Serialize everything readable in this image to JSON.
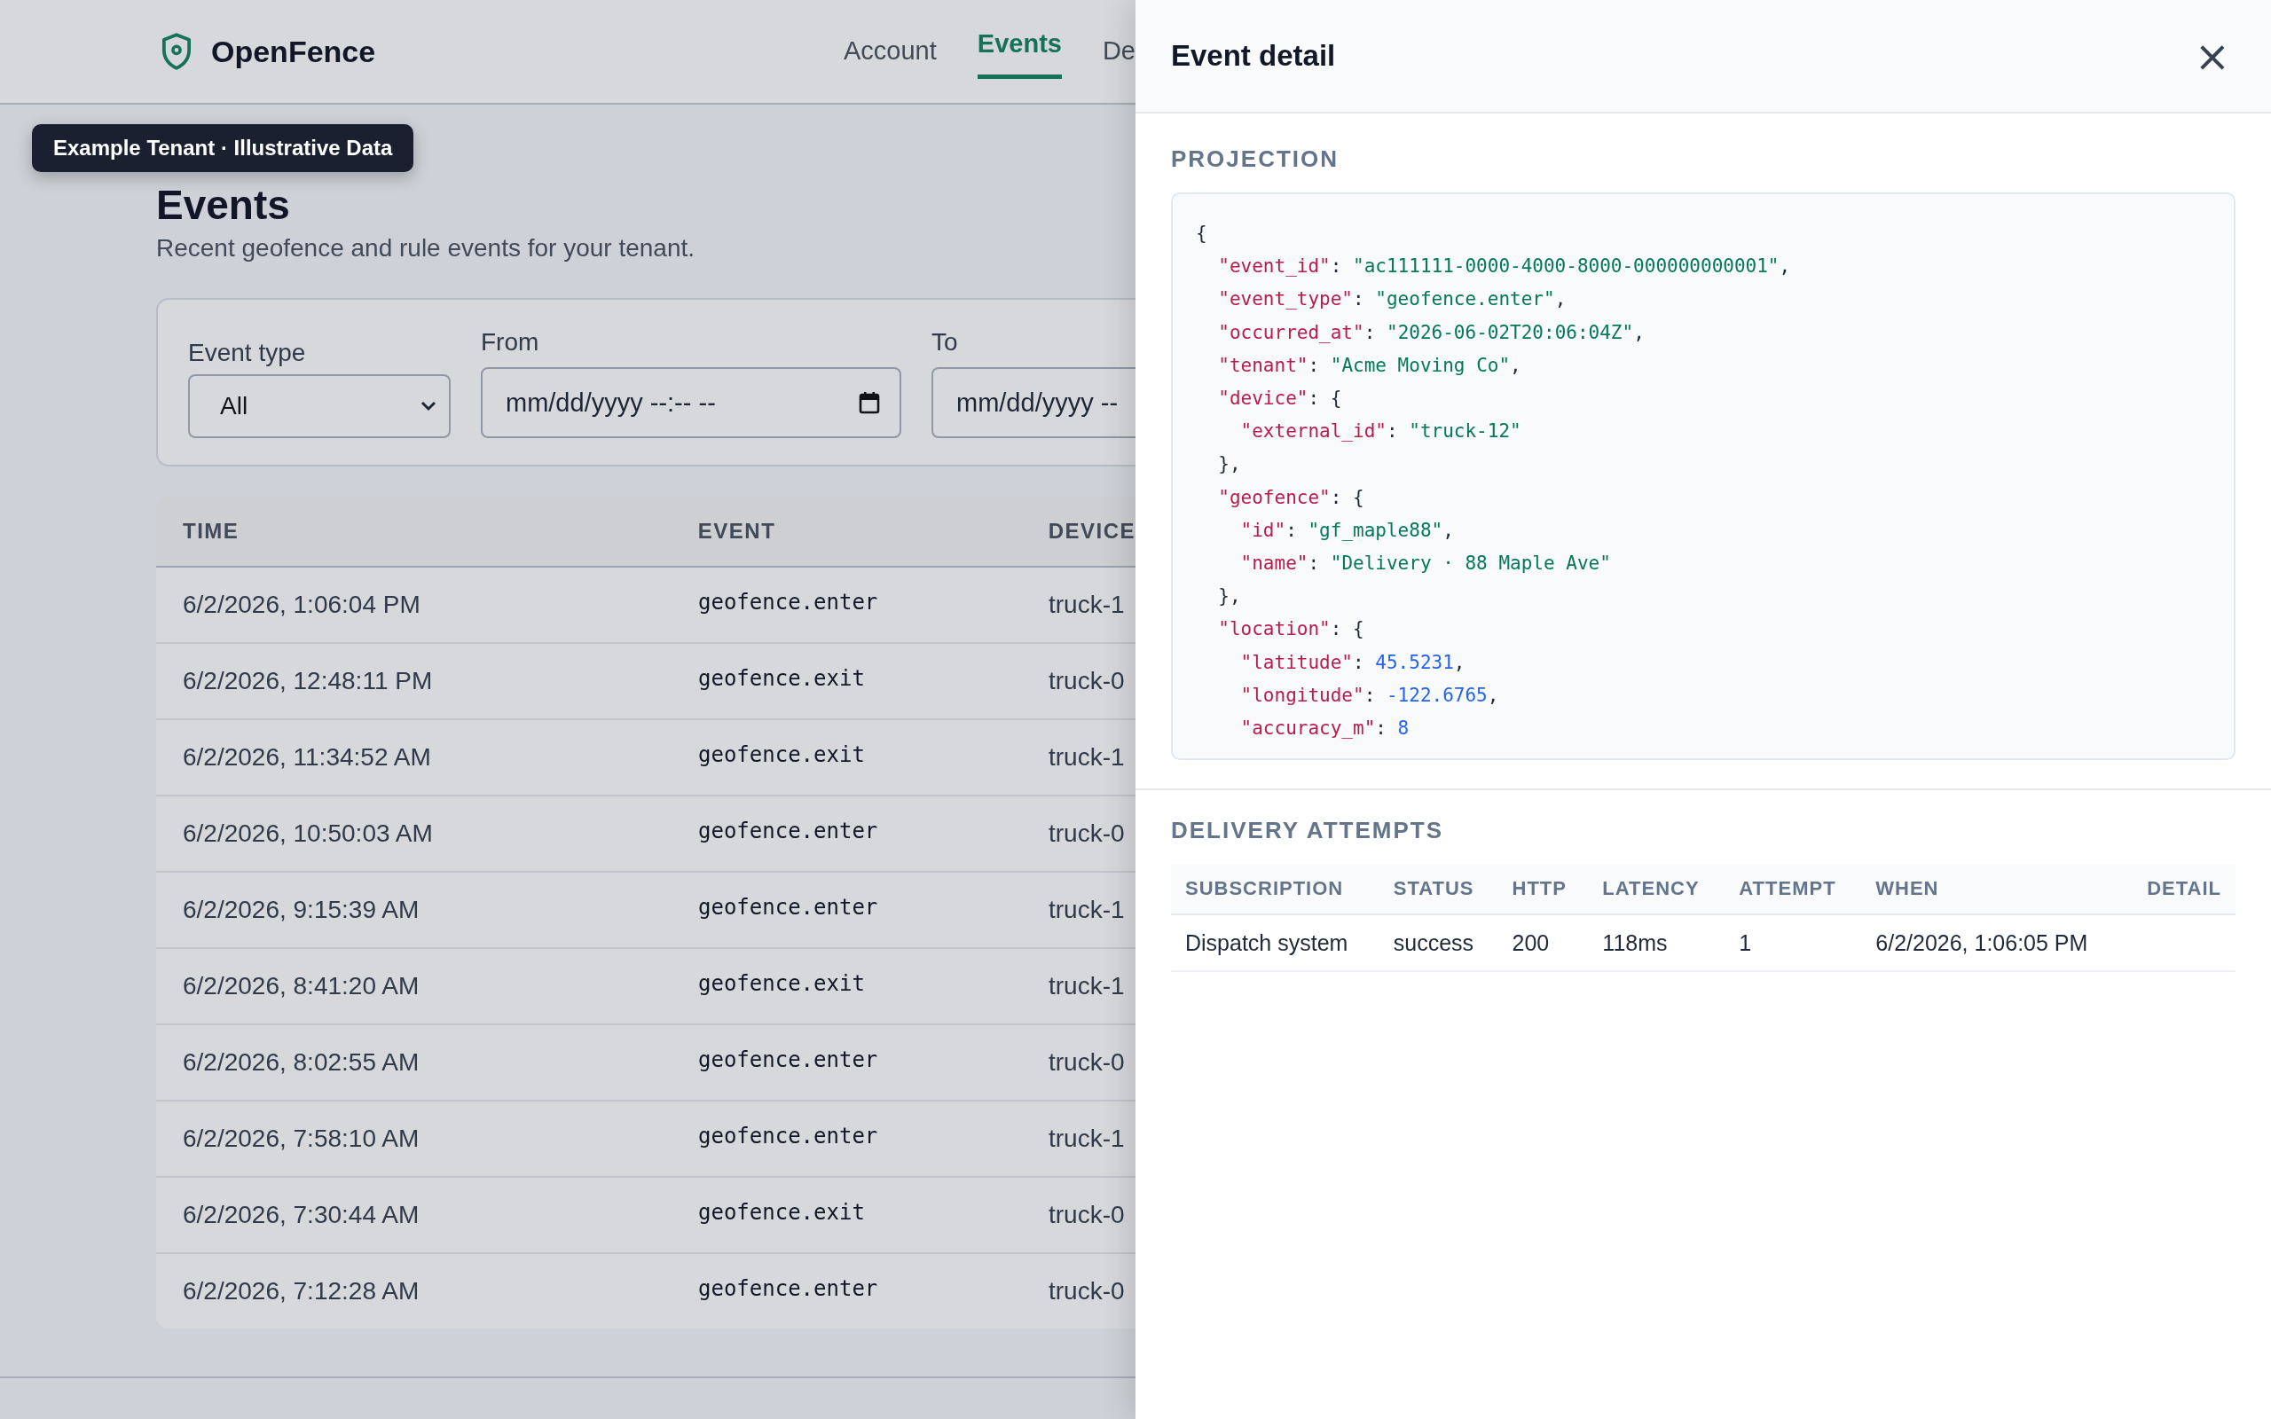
{
  "header": {
    "brand": "OpenFence",
    "nav": [
      {
        "label": "Account",
        "selected": false
      },
      {
        "label": "Events",
        "selected": true
      },
      {
        "label": "De",
        "selected": false
      }
    ]
  },
  "badge": "Example Tenant · Illustrative Data",
  "page": {
    "title": "Events",
    "subtitle": "Recent geofence and rule events for your tenant."
  },
  "filters": {
    "event_type": {
      "label": "Event type",
      "value": "All"
    },
    "from": {
      "label": "From",
      "placeholder": "mm/dd/yyyy --:-- --"
    },
    "to": {
      "label": "To",
      "placeholder": "mm/dd/yyyy --"
    }
  },
  "events_table": {
    "columns": [
      "TIME",
      "EVENT",
      "DEVICE"
    ],
    "rows": [
      {
        "time": "6/2/2026, 1:06:04 PM",
        "event": "geofence.enter",
        "device": "truck-1"
      },
      {
        "time": "6/2/2026, 12:48:11 PM",
        "event": "geofence.exit",
        "device": "truck-0"
      },
      {
        "time": "6/2/2026, 11:34:52 AM",
        "event": "geofence.exit",
        "device": "truck-1"
      },
      {
        "time": "6/2/2026, 10:50:03 AM",
        "event": "geofence.enter",
        "device": "truck-0"
      },
      {
        "time": "6/2/2026, 9:15:39 AM",
        "event": "geofence.enter",
        "device": "truck-1"
      },
      {
        "time": "6/2/2026, 8:41:20 AM",
        "event": "geofence.exit",
        "device": "truck-1"
      },
      {
        "time": "6/2/2026, 8:02:55 AM",
        "event": "geofence.enter",
        "device": "truck-0"
      },
      {
        "time": "6/2/2026, 7:58:10 AM",
        "event": "geofence.enter",
        "device": "truck-1"
      },
      {
        "time": "6/2/2026, 7:30:44 AM",
        "event": "geofence.exit",
        "device": "truck-0"
      },
      {
        "time": "6/2/2026, 7:12:28 AM",
        "event": "geofence.enter",
        "device": "truck-0"
      }
    ]
  },
  "detail_panel": {
    "title": "Event detail",
    "close": "×",
    "projection": {
      "heading": "PROJECTION",
      "lines": [
        "{",
        "  \"event_id\": \"ac111111-0000-4000-8000-000000000001\",",
        "  \"event_type\": \"geofence.enter\",",
        "  \"occurred_at\": \"2026-06-02T20:06:04Z\",",
        "  \"tenant\": \"Acme Moving Co\",",
        "  \"device\": {",
        "    \"external_id\": \"truck-12\"",
        "  },",
        "  \"geofence\": {",
        "    \"id\": \"gf_maple88\",",
        "    \"name\": \"Delivery · 88 Maple Ave\"",
        "  },",
        "  \"location\": {",
        "    \"latitude\": 45.5231,",
        "    \"longitude\": -122.6765,",
        "    \"accuracy_m\": 8"
      ]
    },
    "delivery": {
      "heading": "DELIVERY ATTEMPTS",
      "columns": [
        "SUBSCRIPTION",
        "STATUS",
        "HTTP",
        "LATENCY",
        "ATTEMPT",
        "WHEN",
        "DETAIL"
      ],
      "rows": [
        {
          "subscription": "Dispatch system",
          "status": "success",
          "http": "200",
          "latency": "118ms",
          "attempt": "1",
          "when": "6/2/2026, 1:06:05 PM"
        }
      ]
    }
  }
}
